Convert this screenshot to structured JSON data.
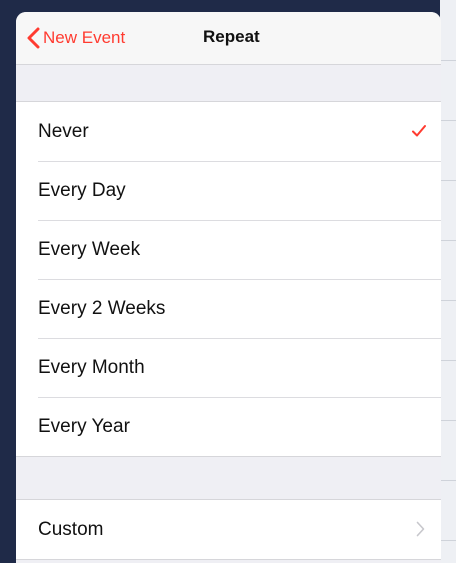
{
  "navbar": {
    "back_label": "New Event",
    "title": "Repeat"
  },
  "repeat_options": [
    {
      "label": "Never",
      "selected": true
    },
    {
      "label": "Every Day",
      "selected": false
    },
    {
      "label": "Every Week",
      "selected": false
    },
    {
      "label": "Every 2 Weeks",
      "selected": false
    },
    {
      "label": "Every Month",
      "selected": false
    },
    {
      "label": "Every Year",
      "selected": false
    }
  ],
  "custom": {
    "label": "Custom"
  },
  "icons": {
    "back": "chevron-left-icon",
    "selected": "checkmark-icon",
    "disclosure": "chevron-right-icon"
  },
  "colors": {
    "accent": "#ff3b30",
    "background": "#efeff4",
    "row_background": "#ffffff",
    "disclosure": "#c7c7cc"
  }
}
